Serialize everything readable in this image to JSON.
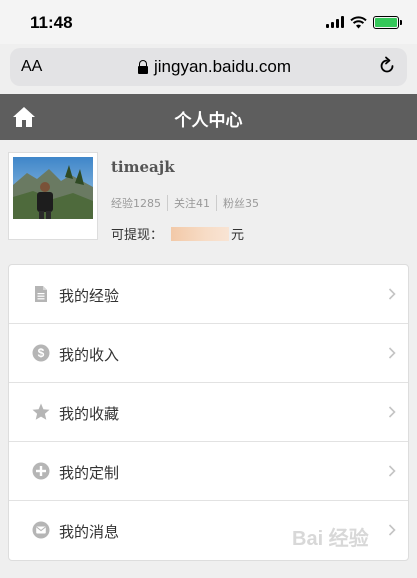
{
  "status_bar": {
    "time": "11:48"
  },
  "browser": {
    "text_size_label": "AA",
    "url": "jingyan.baidu.com"
  },
  "header": {
    "title": "个人中心"
  },
  "profile": {
    "username": "timeajk",
    "stats": [
      {
        "label": "经验",
        "value": "1285",
        "text": "经验1285"
      },
      {
        "label": "关注",
        "value": "41",
        "text": "关注41"
      },
      {
        "label": "粉丝",
        "value": "35",
        "text": "粉丝35"
      }
    ],
    "withdraw_label": "可提现：",
    "currency_unit": "元"
  },
  "menu": {
    "items": [
      {
        "label": "我的经验",
        "icon": "document-icon"
      },
      {
        "label": "我的收入",
        "icon": "dollar-coin-icon"
      },
      {
        "label": "我的收藏",
        "icon": "star-icon"
      },
      {
        "label": "我的定制",
        "icon": "plus-circle-icon"
      },
      {
        "label": "我的消息",
        "icon": "message-icon"
      }
    ]
  },
  "watermark": {
    "text": "Bai 经验"
  },
  "colors": {
    "header_bg": "#5e5e5e",
    "page_bg": "#efefef",
    "icon_gray": "#b5b5b5"
  }
}
